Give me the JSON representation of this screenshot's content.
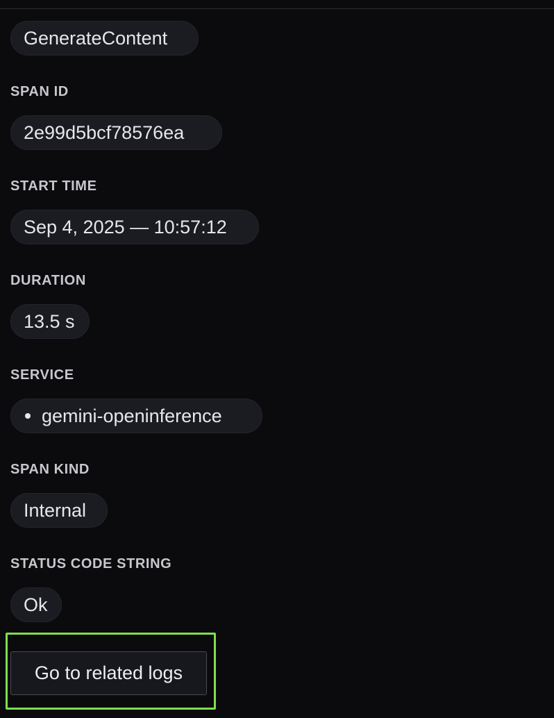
{
  "top": {
    "name_value": "GenerateContent"
  },
  "fields": {
    "span_id": {
      "label": "SPAN ID",
      "value": "2e99d5bcf78576ea"
    },
    "start_time": {
      "label": "START TIME",
      "value": "Sep 4, 2025 — 10:57:12"
    },
    "duration": {
      "label": "DURATION",
      "value": "13.5 s"
    },
    "service": {
      "label": "SERVICE",
      "value": "gemini-openinference"
    },
    "span_kind": {
      "label": "SPAN KIND",
      "value": "Internal"
    },
    "status_code": {
      "label": "STATUS CODE STRING",
      "value": "Ok"
    }
  },
  "actions": {
    "related_logs_label": "Go to related logs"
  },
  "colors": {
    "background": "#0b0b0d",
    "pill": "#1b1c22",
    "highlight": "#7de04f"
  }
}
